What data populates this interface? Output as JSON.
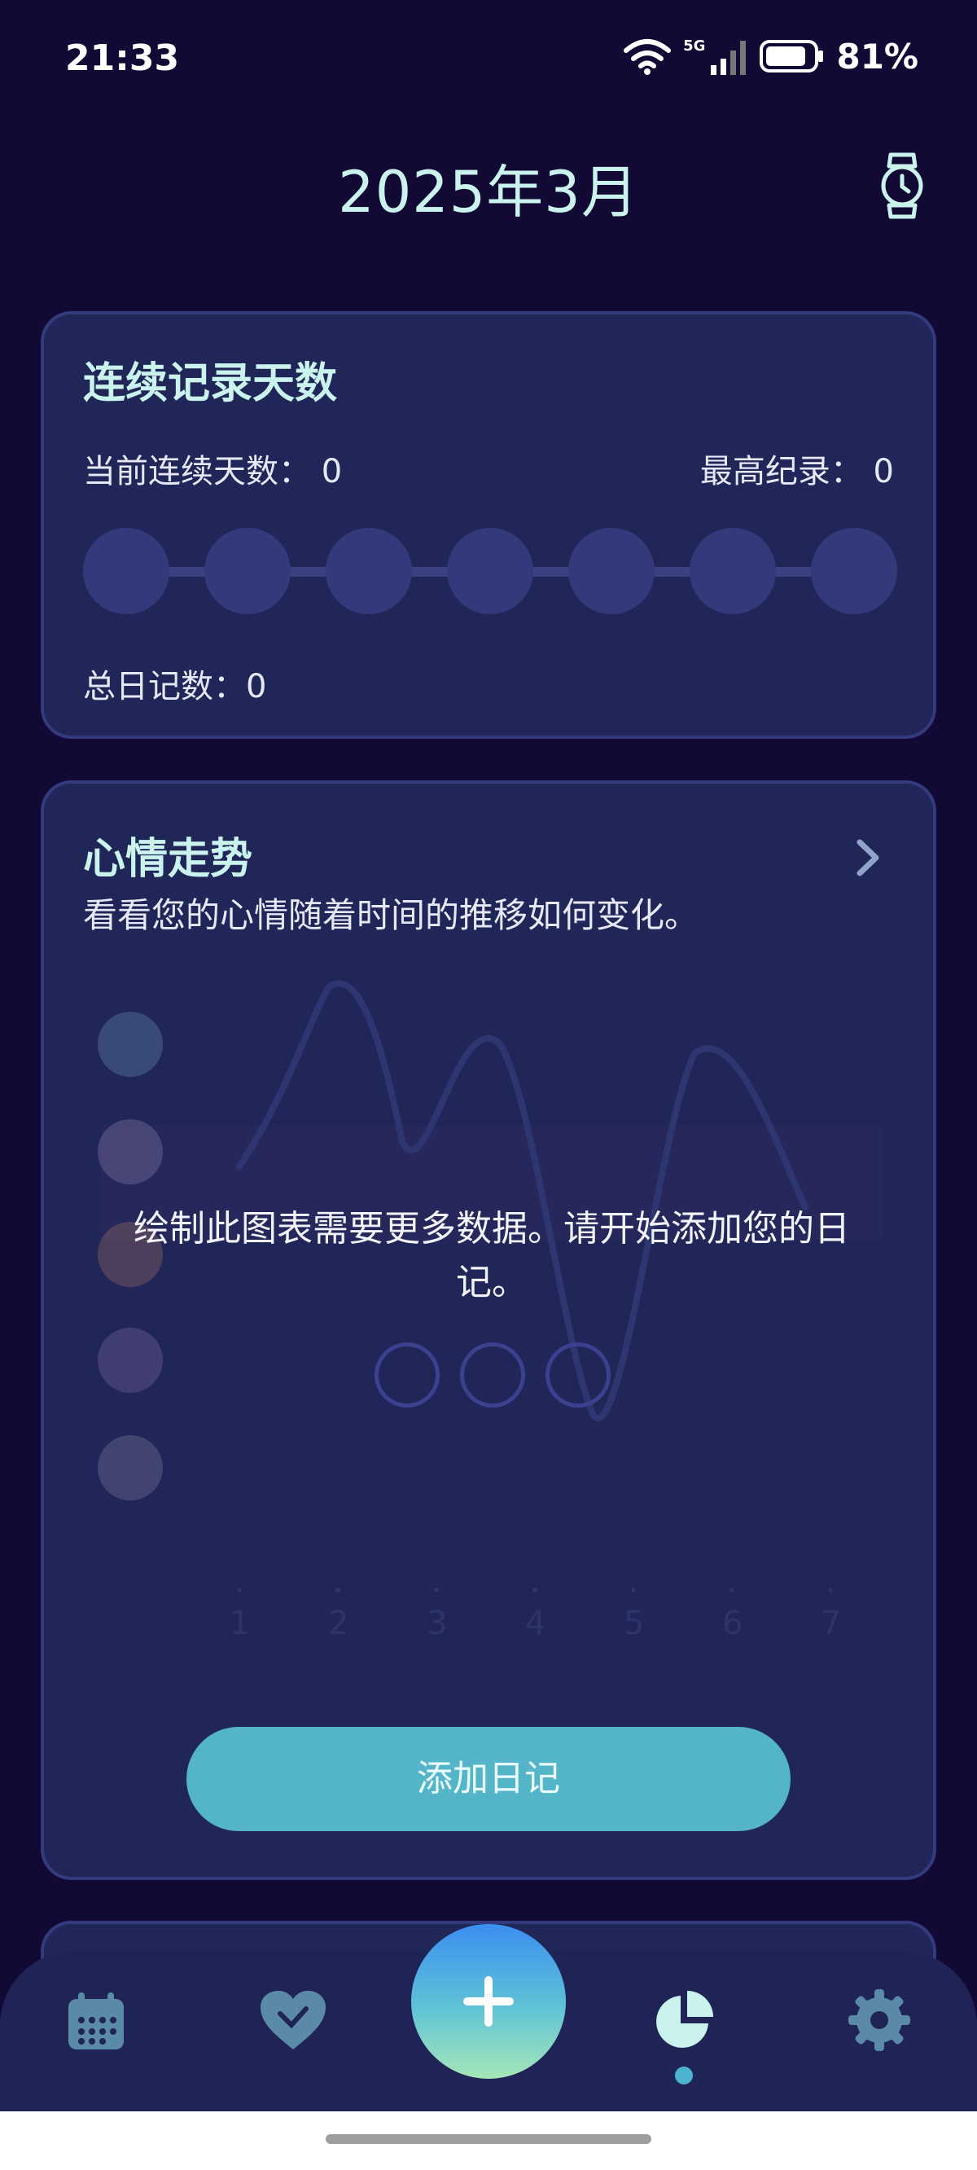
{
  "status_bar": {
    "time": "21:33",
    "network": "5G",
    "battery": "81%"
  },
  "header": {
    "title": "2025年3月",
    "watch_icon": "watch-icon"
  },
  "streak_card": {
    "title": "连续记录天数",
    "current_streak": "当前连续天数： 0",
    "best_record": "最高纪录： 0",
    "total_diaries": "总日记数：0",
    "dot_count": 7
  },
  "mood_card": {
    "title": "心情走势",
    "subtitle": "看看您的心情随着时间的推移如何变化。",
    "empty_message": "绘制此图表需要更多数据。请开始添加您的日记。",
    "add_button": "添加日记",
    "x_ticks": [
      "1",
      "2",
      "3",
      "4",
      "5",
      "6",
      "7"
    ],
    "mood_faces": [
      "very-happy-face",
      "happy-face",
      "angry-face",
      "sad-face",
      "tired-face"
    ]
  },
  "bottom_nav": {
    "items": [
      {
        "name": "calendar",
        "icon": "calendar-icon"
      },
      {
        "name": "mood",
        "icon": "heart-icon"
      },
      {
        "name": "add",
        "icon": "plus-icon"
      },
      {
        "name": "stats",
        "icon": "pie-chart-icon",
        "active": true
      },
      {
        "name": "settings",
        "icon": "gear-icon"
      }
    ]
  },
  "colors": {
    "background": "#120a35",
    "card": "#212659",
    "accent": "#c9f3ec",
    "button": "#53b5c7"
  }
}
